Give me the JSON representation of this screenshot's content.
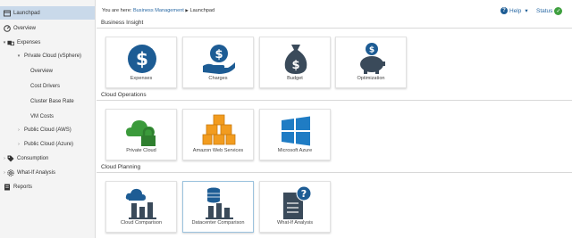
{
  "sidebar": {
    "items": [
      {
        "label": "Launchpad",
        "icon": "launchpad-icon"
      },
      {
        "label": "Overview",
        "icon": "dashboard-icon"
      },
      {
        "label": "Expenses",
        "caret": "▾",
        "icon": "expenses-icon"
      },
      {
        "label": "Private Cloud (vSphere)",
        "caret": "▾"
      },
      {
        "label": "Overview"
      },
      {
        "label": "Cost Drivers"
      },
      {
        "label": "Cluster Base Rate"
      },
      {
        "label": "VM Costs"
      },
      {
        "label": "Public Cloud (AWS)",
        "caret": "›"
      },
      {
        "label": "Public Cloud (Azure)",
        "caret": "›"
      },
      {
        "label": "Consumption",
        "caret": "›",
        "icon": "tag-icon"
      },
      {
        "label": "What-If Analysis",
        "caret": "›",
        "icon": "gear-icon"
      },
      {
        "label": "Reports",
        "icon": "report-icon"
      }
    ]
  },
  "topbar": {
    "prefix": "You are here:",
    "crumb_link": "Business Management",
    "separator": "▶",
    "crumb_current": "Launchpad",
    "help_label": "Help",
    "help_caret": "▾",
    "status_label": "Status"
  },
  "sections": [
    {
      "title": "Business Insight",
      "tiles": [
        {
          "label": "Expenses",
          "icon": "dollar-circle-icon"
        },
        {
          "label": "Charges",
          "icon": "dollar-hand-icon"
        },
        {
          "label": "Budget",
          "icon": "money-bag-icon"
        },
        {
          "label": "Optimization",
          "icon": "piggy-bank-icon"
        }
      ]
    },
    {
      "title": "Cloud Operations",
      "tiles": [
        {
          "label": "Private Cloud",
          "icon": "cloud-lock-icon"
        },
        {
          "label": "Amazon Web Services",
          "icon": "aws-cubes-icon"
        },
        {
          "label": "Microsoft Azure",
          "icon": "windows-logo-icon"
        }
      ]
    },
    {
      "title": "Cloud Planning",
      "tiles": [
        {
          "label": "Cloud Comparison",
          "icon": "cloud-chart-icon"
        },
        {
          "label": "Datacenter Comparison",
          "icon": "database-chart-icon"
        },
        {
          "label": "What-If Analysis",
          "icon": "document-question-icon"
        }
      ]
    }
  ],
  "colors": {
    "accent_blue": "#1d5c94",
    "aws_orange": "#f29c1f",
    "cloud_green": "#3b9a3b",
    "azure_blue": "#1f7cc4",
    "active_nav": "#c9d9ea",
    "status_green": "#3fa03f"
  }
}
